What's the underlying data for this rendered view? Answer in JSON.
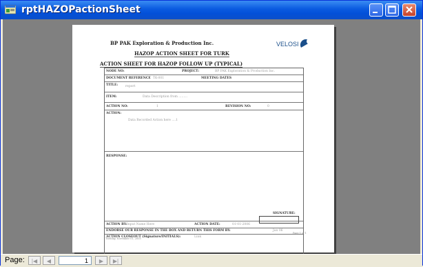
{
  "window": {
    "title": "rptHAZOPactionSheet"
  },
  "report": {
    "company": "BP PAK Exploration & Production Inc.",
    "logo_text": "VELOSI",
    "heading": "HAZOP ACTION SHEET FOR TURK",
    "subheading": "ACTION SHEET FOR HAZOP FOLLOW UP (TYPICAL)",
    "fields": {
      "node_no_label": "NODE NO:",
      "project_label": "PROJECT:",
      "project_value": "BP PAK Exploration & Production Inc.",
      "doc_ref_label": "DOCUMENT REFERENCE",
      "doc_ref_value": "TK-001",
      "meeting_dates_label": "MEETING DATES",
      "title_label": "TITLE:",
      "title_value": "report",
      "item_label": "ITEM:",
      "item_value": "Data Description from .........",
      "action_no_label": "ACTION NO:",
      "action_no_value": "1",
      "revision_label": "REVISION NO:",
      "revision_value": "0",
      "action_label": "ACTION:",
      "action_value": "Data Recorded Action here ....1",
      "response_label": "RESPONSE:",
      "signature_label": "SIGNATURE:",
      "action_by_label": "ACTION BY:",
      "action_by_value": "Input Name Here",
      "action_date_label": "ACTION DATE:",
      "action_date_value": "01-01-2006",
      "endorse_label": "ENDORSE OUR RESPONSE IN THE BOX AND RETURN THIS FORM BY:",
      "endorse_value": "Jan 06",
      "closeout_label": "ACTION CLOSEOUT (Signature/INITIALS):",
      "closeout_value": "Link"
    },
    "page_footer": "Page 1 of 1",
    "date_footer": "Tuesday, November 01, 2005"
  },
  "statusbar": {
    "page_label": "Page:",
    "first_icon": "first-page-icon",
    "prev_icon": "prev-page-icon",
    "next_icon": "next-page-icon",
    "last_icon": "last-page-icon",
    "page_number": "1"
  }
}
